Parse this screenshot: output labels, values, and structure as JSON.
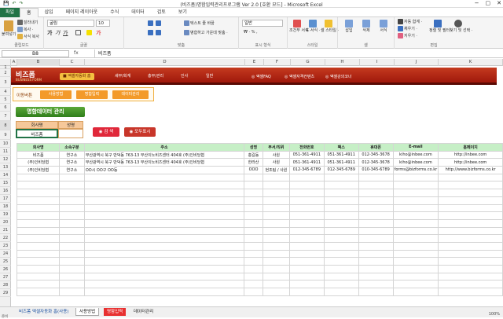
{
  "window": {
    "title": "(비즈폼)명함입력관리프로그램 Ver 2.0  [호환 모드] - Microsoft Excel",
    "qat": [
      "💾",
      "↶",
      "↷"
    ],
    "controls": [
      "−",
      "▢",
      "✕"
    ]
  },
  "tabs": [
    "파일",
    "홈",
    "삽입",
    "페이지 레이아웃",
    "수식",
    "데이터",
    "검토",
    "보기"
  ],
  "ribbon": {
    "clipboard": {
      "paste": "붙여넣기",
      "cut": "잘라내기",
      "copy": "복사 ·",
      "format_painter": "서식 복사",
      "label": "클립보드"
    },
    "font": {
      "name": "굴림",
      "size": "10",
      "label": "글꼴"
    },
    "alignment": {
      "wrap": "텍스트 줄 바꿈",
      "merge": "병합하고 가운데 맞춤 ·",
      "label": "맞춤"
    },
    "number": {
      "format": "일반",
      "label": "표시 형식"
    },
    "styles": {
      "conditional": "조건부 서식 ·",
      "table": "표 서식 ·",
      "cell": "셀 스타일 ·",
      "label": "스타일"
    },
    "cells": {
      "insert": "삽입",
      "delete": "삭제",
      "format": "서식",
      "label": "셀"
    },
    "editing": {
      "autosum": "자동 합계 ·",
      "fill": "채우기 ·",
      "clear": "지우기 ·",
      "sort": "정렬 및 필터 ·",
      "find": "찾기 및 선택 ·",
      "label": "편집"
    }
  },
  "formula_bar": {
    "name_box": "B8",
    "fx": "fx",
    "value": "비즈폼"
  },
  "columns": [
    "A",
    "B",
    "C",
    "D",
    "E",
    "F",
    "G",
    "H",
    "I",
    "J",
    "K"
  ],
  "rows": [
    "1",
    "2",
    "3",
    "4",
    "5",
    "6",
    "7",
    "8",
    "9",
    "10",
    "11",
    "12",
    "13",
    "14",
    "15",
    "16",
    "17",
    "18",
    "19",
    "20",
    "21",
    "22",
    "23",
    "24",
    "25",
    "26",
    "27",
    "28",
    "29"
  ],
  "banner": {
    "logo": "비즈폼",
    "logo_sub": "BUSINESS FORM",
    "nav": [
      "엑셀자동화 홈",
      "세무/회계",
      "총무/관리",
      "인사",
      "일반"
    ],
    "links": [
      "엑셀FAQ",
      "엑셀자격컨텐츠",
      "엑셀강의코너"
    ]
  },
  "subnav": {
    "label": "이동버튼",
    "buttons": [
      "사용방법",
      "명함입력",
      "데이터관리"
    ]
  },
  "db_title": "명함데이터 관리",
  "search": {
    "headers": [
      "회사명",
      "성명"
    ],
    "values": [
      "비즈폼",
      ""
    ],
    "search_button": "검  색",
    "show_all_button": "모두표시"
  },
  "table": {
    "headers": [
      "회사명",
      "소속구분",
      "주소",
      "성명",
      "부서/직위",
      "전화번호",
      "팩스",
      "휴대폰",
      "E-mail",
      "홈페이지"
    ],
    "rows": [
      [
        "비즈폼",
        "연구소",
        "부산광역시 북구 만덕동 763-13 부산이노비즈센터 404호 (주)인비당협",
        "홍길동",
        "사원",
        "051-361-4911",
        "051-361-4911",
        "012-345-3678",
        "kiho@inbee.com",
        "http://inbee.com"
      ],
      [
        "(주)인비당협",
        "연구소",
        "부산광역시 북구 만덕동 763-13 부산이노비즈센터 404호 (주)인비당협",
        "한라산",
        "사원",
        "051-361-4911",
        "051-361-4911",
        "012-345-3678",
        "kiho@inbee.com",
        "http://inbee.com"
      ],
      [
        "(주)인비당협",
        "연구소",
        "OO시 OO구 OO동",
        "OOO",
        "현조팀 / 사원",
        "012-345-6789",
        "012-345-6789",
        "010-345-6789",
        "forms@bizforms.co.kr",
        "http://www.bizforms.co.kr"
      ]
    ]
  },
  "sheet_tabs": [
    "비즈폼 엑셀자동화 홈(사용)",
    "사용방법",
    "명함입력",
    "데이터관리"
  ],
  "status": "준비",
  "zoom": "100%",
  "colors": {
    "excel_green": "#217346",
    "banner_red": "#b8281a",
    "header_green": "#c6efc6",
    "orange": "#f39a2a"
  }
}
